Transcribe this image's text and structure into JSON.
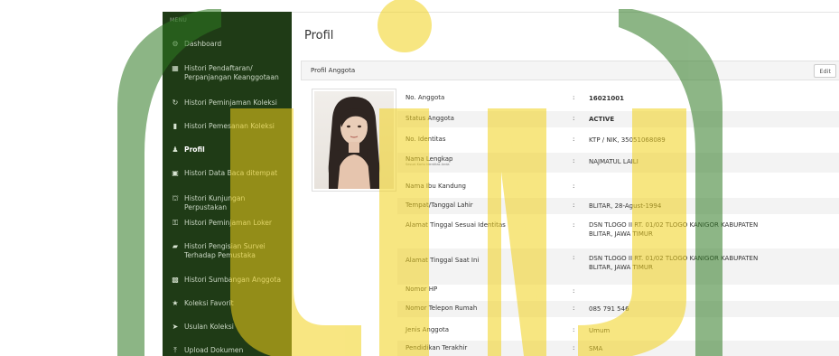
{
  "sidebar": {
    "menu_label": "MENU",
    "items": [
      {
        "icon": "dashboard-icon",
        "label": "Dashboard"
      },
      {
        "icon": "calendar-icon",
        "label": "Histori Pendaftaran/ Perpanjangan Keanggotaan"
      },
      {
        "icon": "history-icon",
        "label": "Histori Peminjaman Koleksi"
      },
      {
        "icon": "bookmark-icon",
        "label": "Histori Pemesanan Koleksi"
      },
      {
        "icon": "user-icon",
        "label": "Profil"
      },
      {
        "icon": "book-icon",
        "label": "Histori Data Baca ditempat"
      },
      {
        "icon": "bank-icon",
        "label": "Histori Kunjungan Perpustakan"
      },
      {
        "icon": "key-icon",
        "label": "Histori Peminjaman Loker"
      },
      {
        "icon": "file-icon",
        "label": "Histori Pengisian Survei Terhadap Pemustaka"
      },
      {
        "icon": "gift-icon",
        "label": "Histori Sumbangan Anggota"
      },
      {
        "icon": "star-icon",
        "label": "Koleksi Favorit"
      },
      {
        "icon": "send-icon",
        "label": "Usulan Koleksi"
      },
      {
        "icon": "upload-icon",
        "label": "Upload Dokumen"
      }
    ]
  },
  "main": {
    "title": "Profil",
    "panel_title": "Profil Anggota",
    "edit_label": "Edit"
  },
  "profile": [
    {
      "label": "No. Anggota",
      "value": "16021001",
      "bold": true
    },
    {
      "label": "Status Anggota",
      "value": "ACTIVE",
      "bold": true
    },
    {
      "label": "No. Identitas",
      "value": "KTP / NIK, 35051068089"
    },
    {
      "label": "Nama Lengkap",
      "sub": "Sesuai Kartu Identitas Anda",
      "value": "NAJMATUL LAILI"
    },
    {
      "label": "Nama Ibu Kandung",
      "value": ""
    },
    {
      "label": "Tempat/Tanggal Lahir",
      "value": "BLITAR, 28-Agust-1994"
    },
    {
      "label": "Alamat Tinggal Sesuai Identitas",
      "value": "DSN TLOGO II RT. 01/02 TLOGO KANIGOR KABUPATEN BLITAR, JAWA TIMUR"
    },
    {
      "label": "Alamat Tinggal Saat Ini",
      "value": "DSN TLOGO II RT. 01/02 TLOGO KANIGOR KABUPATEN BLITAR, JAWA TIMUR"
    },
    {
      "label": "Nomor HP",
      "value": ""
    },
    {
      "label": "Nomor Telepon Rumah",
      "value": "085 791 546"
    },
    {
      "label": "Jenis Anggota",
      "value": "Umum"
    },
    {
      "label": "Pendidikan Terakhir",
      "value": "SMA"
    }
  ],
  "colors": {
    "sidebar_bg": "#1f3b16",
    "watermark_yellow": "#f2d21b",
    "watermark_green": "#2f7a22"
  }
}
